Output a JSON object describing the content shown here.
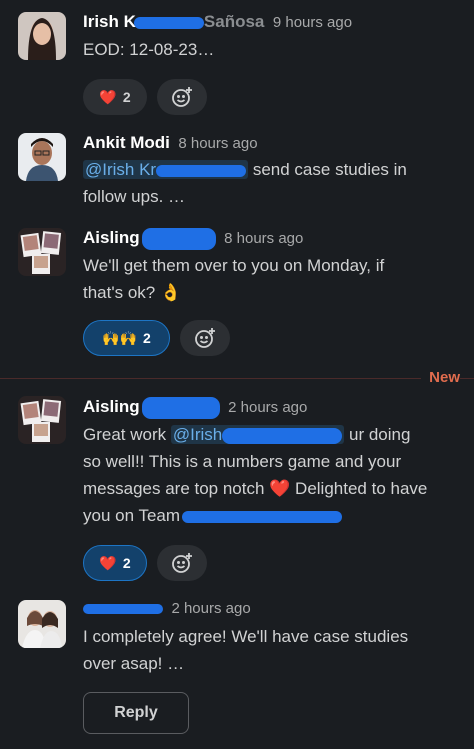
{
  "messages": [
    {
      "author": "Irish K",
      "author_tail": "Sañosa",
      "time": "9 hours ago",
      "body": "EOD: 12-08-23…",
      "reactions": [
        {
          "emoji": "❤️",
          "count": "2"
        }
      ]
    },
    {
      "author": "Ankit Modi",
      "time": "8 hours ago",
      "mention": "@Irish Kr",
      "body_after": "send case studies in",
      "body_line2": "follow ups. …"
    },
    {
      "author": "Aisling",
      "time": "8 hours ago",
      "body_line1": "We'll get them over to you on Monday, if",
      "body_line2": "that's ok? 👌",
      "reactions": [
        {
          "emoji": "🙌🙌",
          "count": "2"
        }
      ]
    },
    {
      "author": "Aisling",
      "time": "2 hours ago",
      "line1_start": "Great work",
      "mention": "@Irish",
      "line1_end": "ur doing",
      "body_line2": "so well!! This is a numbers game and your",
      "body_line3": "messages are top notch ❤️  Delighted to have",
      "body_line4": "you on Team",
      "reactions": [
        {
          "emoji": "❤️",
          "count": "2"
        }
      ]
    },
    {
      "time": "2 hours ago",
      "body_line1": "I completely agree! We'll have case studies",
      "body_line2": "over asap! …"
    }
  ],
  "new_label": "New",
  "reply_label": "Reply",
  "icons": {
    "add_reaction": "add-reaction-icon"
  },
  "colors": {
    "background": "#1a1d21",
    "mention": "#6aaee8",
    "new": "#e06c4e",
    "active_reaction": "#13416b"
  }
}
